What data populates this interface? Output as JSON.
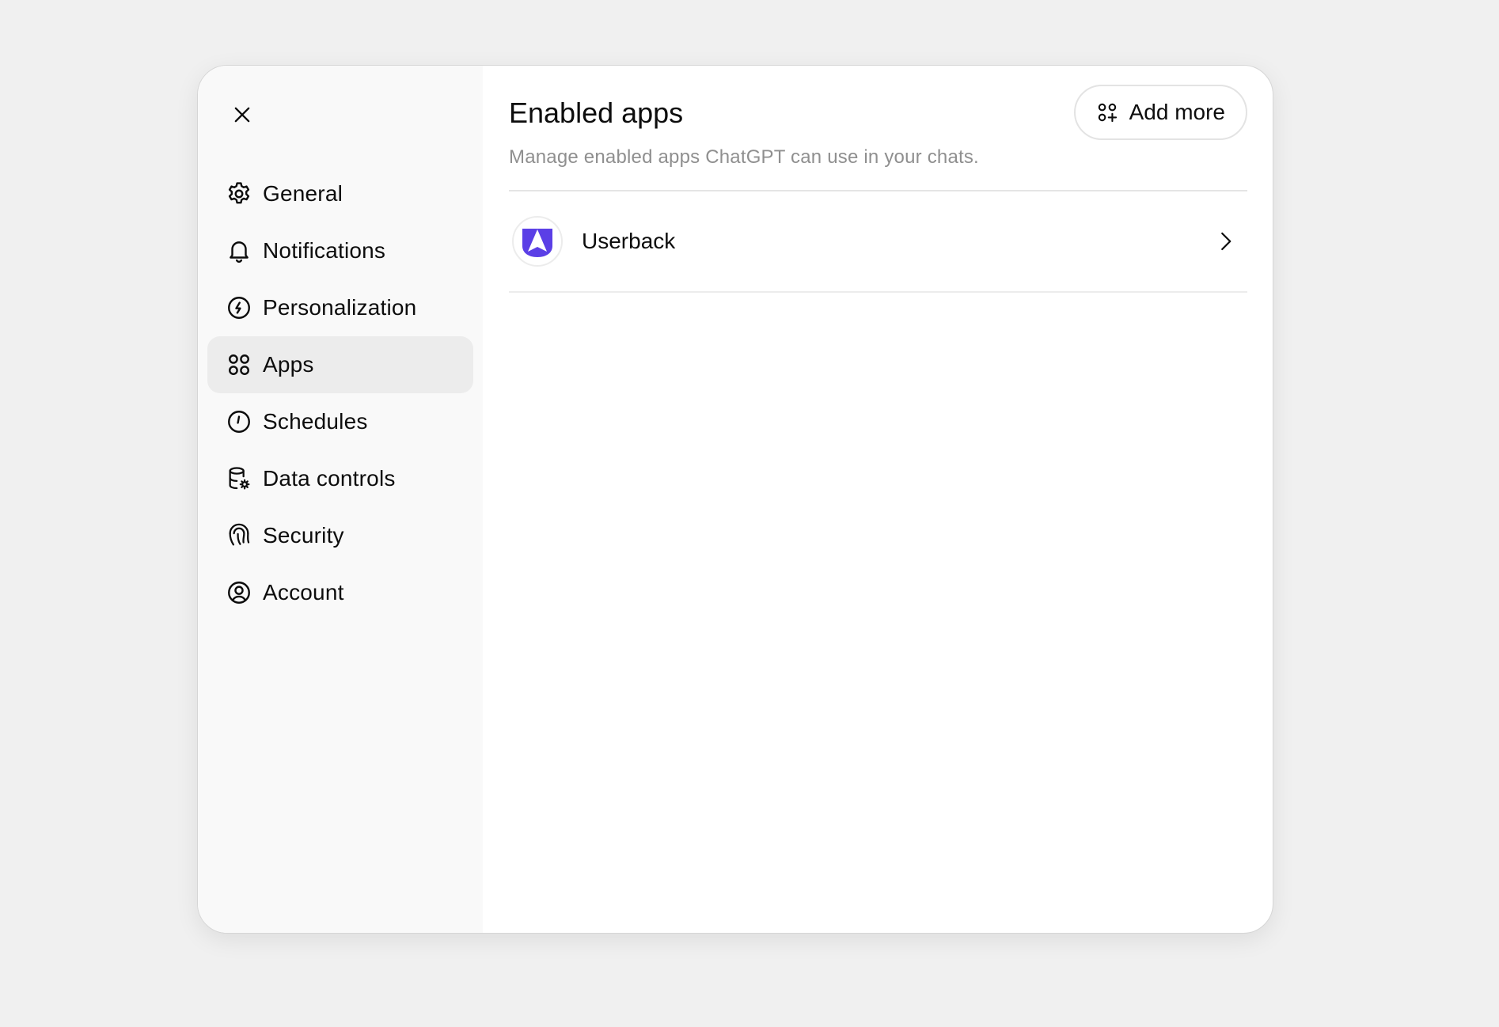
{
  "sidebar": {
    "close_label": "Close",
    "items": [
      {
        "label": "General",
        "icon": "gear-icon",
        "active": false
      },
      {
        "label": "Notifications",
        "icon": "bell-icon",
        "active": false
      },
      {
        "label": "Personalization",
        "icon": "personalization-icon",
        "active": false
      },
      {
        "label": "Apps",
        "icon": "apps-grid-icon",
        "active": true
      },
      {
        "label": "Schedules",
        "icon": "clock-icon",
        "active": false
      },
      {
        "label": "Data controls",
        "icon": "database-gear-icon",
        "active": false
      },
      {
        "label": "Security",
        "icon": "fingerprint-icon",
        "active": false
      },
      {
        "label": "Account",
        "icon": "user-circle-icon",
        "active": false
      }
    ]
  },
  "main": {
    "title": "Enabled apps",
    "subtitle": "Manage enabled apps ChatGPT can use in your chats.",
    "add_more_label": "Add more",
    "apps": [
      {
        "name": "Userback",
        "logo": "userback-logo",
        "logo_color": "#5b3fe6"
      }
    ]
  },
  "colors": {
    "page_bg": "#f0f0f0",
    "sidebar_bg": "#f9f9f9",
    "active_item_bg": "#ececec",
    "text_primary": "#0d0d0d",
    "text_secondary": "#8f8f8f"
  }
}
